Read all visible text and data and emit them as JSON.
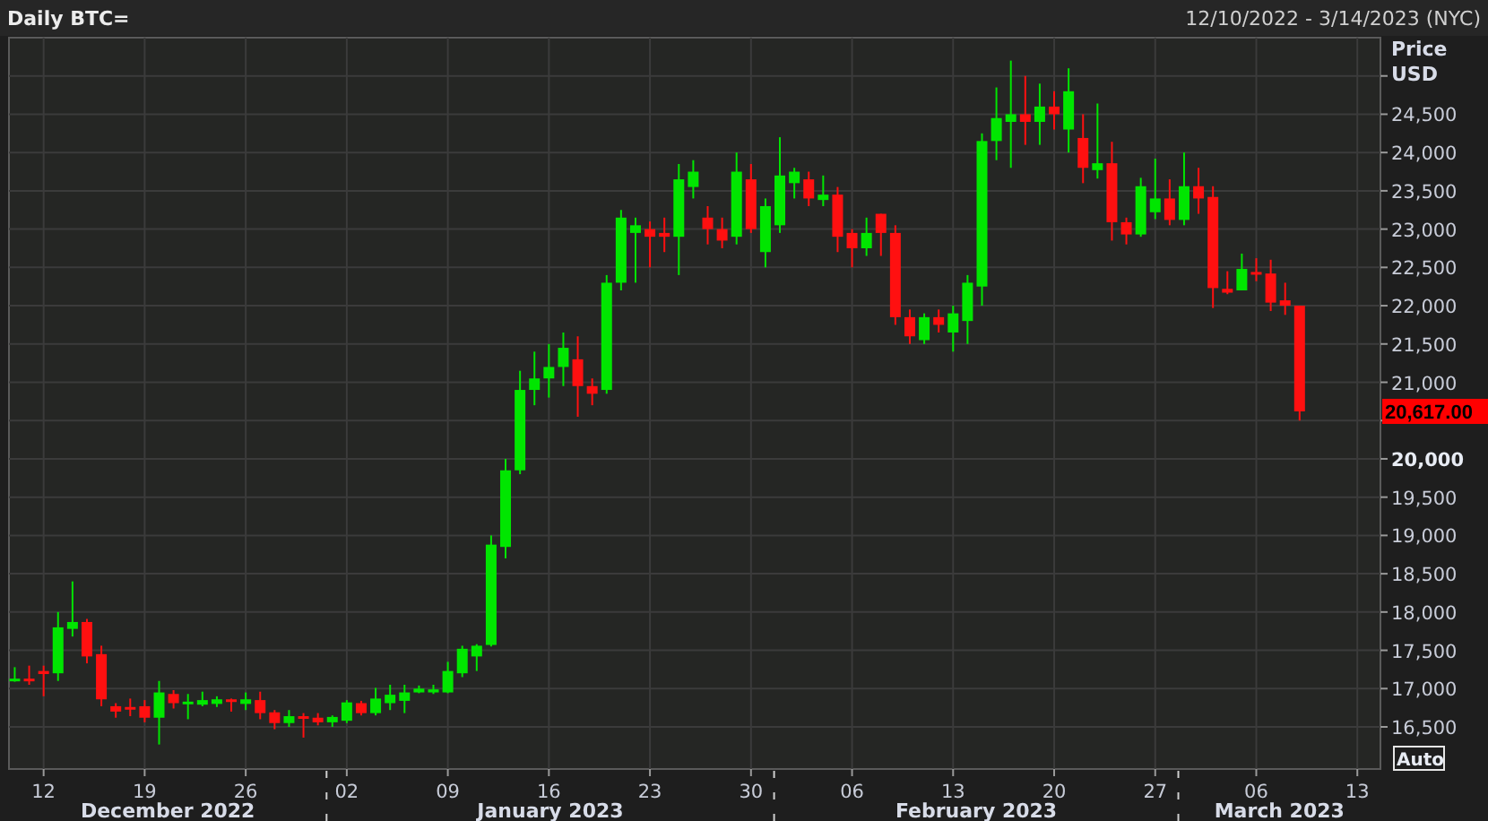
{
  "header": {
    "title": "Daily BTC=",
    "date_range": "12/10/2022 - 3/14/2023 (NYC)"
  },
  "chart": {
    "last_price": "20,617.00",
    "auto_button": "Auto",
    "month_labels": [
      "December 2022",
      "January 2023",
      "February 2023",
      "March 2023"
    ],
    "chart_data": {
      "type": "candlestick",
      "ylabel": "Price USD",
      "grid": true,
      "categories": [
        null,
        null,
        "12",
        null,
        null,
        null,
        null,
        null,
        null,
        "19",
        null,
        null,
        null,
        null,
        null,
        null,
        "26",
        null,
        null,
        null,
        null,
        null,
        null,
        "02",
        null,
        null,
        null,
        null,
        null,
        null,
        "09",
        null,
        null,
        null,
        null,
        null,
        null,
        "16",
        null,
        null,
        null,
        null,
        null,
        null,
        "23",
        null,
        null,
        null,
        null,
        null,
        null,
        "30",
        null,
        null,
        null,
        null,
        null,
        null,
        "06",
        null,
        null,
        null,
        null,
        null,
        null,
        "13",
        null,
        null,
        null,
        null,
        null,
        null,
        "20",
        null,
        null,
        null,
        null,
        null,
        null,
        "27",
        null,
        null,
        null,
        null,
        null,
        null,
        "06",
        null,
        null,
        null,
        null,
        null,
        null,
        "13",
        null
      ],
      "ohlc": [
        [
          17100,
          17280,
          17090,
          17130
        ],
        [
          17130,
          17300,
          17050,
          17100
        ],
        [
          17230,
          17300,
          16900,
          17190
        ],
        [
          17200,
          18000,
          17100,
          17800
        ],
        [
          17780,
          18400,
          17680,
          17870
        ],
        [
          17870,
          17910,
          17330,
          17420
        ],
        [
          17450,
          17560,
          16770,
          16860
        ],
        [
          16770,
          16810,
          16620,
          16700
        ],
        [
          16760,
          16870,
          16640,
          16730
        ],
        [
          16770,
          16850,
          16560,
          16620
        ],
        [
          16620,
          17100,
          16270,
          16950
        ],
        [
          16930,
          16980,
          16740,
          16810
        ],
        [
          16800,
          16930,
          16600,
          16830
        ],
        [
          16790,
          16960,
          16770,
          16850
        ],
        [
          16800,
          16900,
          16760,
          16860
        ],
        [
          16860,
          16870,
          16700,
          16840
        ],
        [
          16800,
          16950,
          16720,
          16860
        ],
        [
          16850,
          16960,
          16600,
          16680
        ],
        [
          16690,
          16720,
          16470,
          16550
        ],
        [
          16550,
          16720,
          16500,
          16640
        ],
        [
          16640,
          16680,
          16360,
          16610
        ],
        [
          16620,
          16680,
          16520,
          16560
        ],
        [
          16560,
          16650,
          16500,
          16630
        ],
        [
          16580,
          16850,
          16550,
          16820
        ],
        [
          16810,
          16840,
          16650,
          16680
        ],
        [
          16680,
          17010,
          16650,
          16870
        ],
        [
          16810,
          17050,
          16720,
          16920
        ],
        [
          16840,
          17050,
          16680,
          16950
        ],
        [
          16950,
          17040,
          16940,
          17000
        ],
        [
          16950,
          17050,
          16930,
          16990
        ],
        [
          16950,
          17350,
          16940,
          17230
        ],
        [
          17200,
          17560,
          17150,
          17520
        ],
        [
          17420,
          17580,
          17230,
          17560
        ],
        [
          17570,
          19000,
          17550,
          18880
        ],
        [
          18850,
          20000,
          18700,
          19850
        ],
        [
          19850,
          21150,
          19800,
          20900
        ],
        [
          20900,
          21400,
          20700,
          21050
        ],
        [
          21050,
          21500,
          20800,
          21200
        ],
        [
          21200,
          21650,
          20950,
          21450
        ],
        [
          21300,
          21600,
          20550,
          20950
        ],
        [
          20950,
          21050,
          20700,
          20850
        ],
        [
          20900,
          22400,
          20850,
          22300
        ],
        [
          22300,
          23250,
          22200,
          23150
        ],
        [
          22950,
          23150,
          22300,
          23050
        ],
        [
          23000,
          23100,
          22500,
          22900
        ],
        [
          22950,
          23150,
          22700,
          22900
        ],
        [
          22900,
          23850,
          22400,
          23650
        ],
        [
          23550,
          23900,
          23400,
          23750
        ],
        [
          23150,
          23300,
          22800,
          23000
        ],
        [
          23000,
          23150,
          22750,
          22850
        ],
        [
          22900,
          24000,
          22800,
          23750
        ],
        [
          23650,
          23850,
          22950,
          23000
        ],
        [
          22700,
          23400,
          22500,
          23300
        ],
        [
          23050,
          24200,
          22950,
          23700
        ],
        [
          23600,
          23800,
          23400,
          23750
        ],
        [
          23650,
          23750,
          23300,
          23400
        ],
        [
          23380,
          23700,
          23300,
          23450
        ],
        [
          23450,
          23550,
          22700,
          22900
        ],
        [
          22950,
          23000,
          22500,
          22750
        ],
        [
          22750,
          23150,
          22650,
          22950
        ],
        [
          23200,
          23200,
          22650,
          22950
        ],
        [
          22950,
          23050,
          21750,
          21850
        ],
        [
          21850,
          21950,
          21500,
          21600
        ],
        [
          21550,
          21900,
          21500,
          21850
        ],
        [
          21850,
          21950,
          21650,
          21750
        ],
        [
          21650,
          22000,
          21400,
          21900
        ],
        [
          21800,
          22400,
          21500,
          22300
        ],
        [
          22250,
          24250,
          22000,
          24150
        ],
        [
          24150,
          24850,
          23900,
          24450
        ],
        [
          24400,
          25200,
          23800,
          24500
        ],
        [
          24500,
          25000,
          24100,
          24400
        ],
        [
          24400,
          24900,
          24100,
          24600
        ],
        [
          24600,
          24800,
          24300,
          24500
        ],
        [
          24300,
          25100,
          24000,
          24800
        ],
        [
          24190,
          24500,
          23600,
          23800
        ],
        [
          23770,
          24640,
          23660,
          23860
        ],
        [
          23860,
          24140,
          22850,
          23090
        ],
        [
          23090,
          23150,
          22800,
          22930
        ],
        [
          22930,
          23670,
          22900,
          23560
        ],
        [
          23220,
          23920,
          23130,
          23400
        ],
        [
          23400,
          23650,
          23050,
          23120
        ],
        [
          23120,
          24000,
          23050,
          23560
        ],
        [
          23560,
          23800,
          23200,
          23400
        ],
        [
          23420,
          23560,
          21970,
          22230
        ],
        [
          22220,
          22450,
          22150,
          22170
        ],
        [
          22200,
          22680,
          22200,
          22480
        ],
        [
          22440,
          22620,
          22320,
          22410
        ],
        [
          22420,
          22600,
          21930,
          22040
        ],
        [
          22070,
          22300,
          21880,
          22000
        ],
        [
          22000,
          22000,
          20500,
          20620
        ],
        null,
        null,
        null,
        null,
        null
      ],
      "ylim": [
        15950,
        25500
      ],
      "yticks": [
        {
          "value": 16500,
          "label": "16,500"
        },
        {
          "value": 17000,
          "label": "17,000"
        },
        {
          "value": 17500,
          "label": "17,500"
        },
        {
          "value": 18000,
          "label": "18,000"
        },
        {
          "value": 18500,
          "label": "18,500"
        },
        {
          "value": 19000,
          "label": "19,000"
        },
        {
          "value": 19500,
          "label": "19,500"
        },
        {
          "value": 20000,
          "label": "20,000"
        },
        {
          "value": 21000,
          "label": "21,000"
        },
        {
          "value": 21500,
          "label": "21,500"
        },
        {
          "value": 22000,
          "label": "22,000"
        },
        {
          "value": 22500,
          "label": "22,500"
        },
        {
          "value": 23000,
          "label": "23,000"
        },
        {
          "value": 23500,
          "label": "23,500"
        },
        {
          "value": 24000,
          "label": "24,000"
        },
        {
          "value": 24500,
          "label": "24,500"
        }
      ]
    }
  }
}
